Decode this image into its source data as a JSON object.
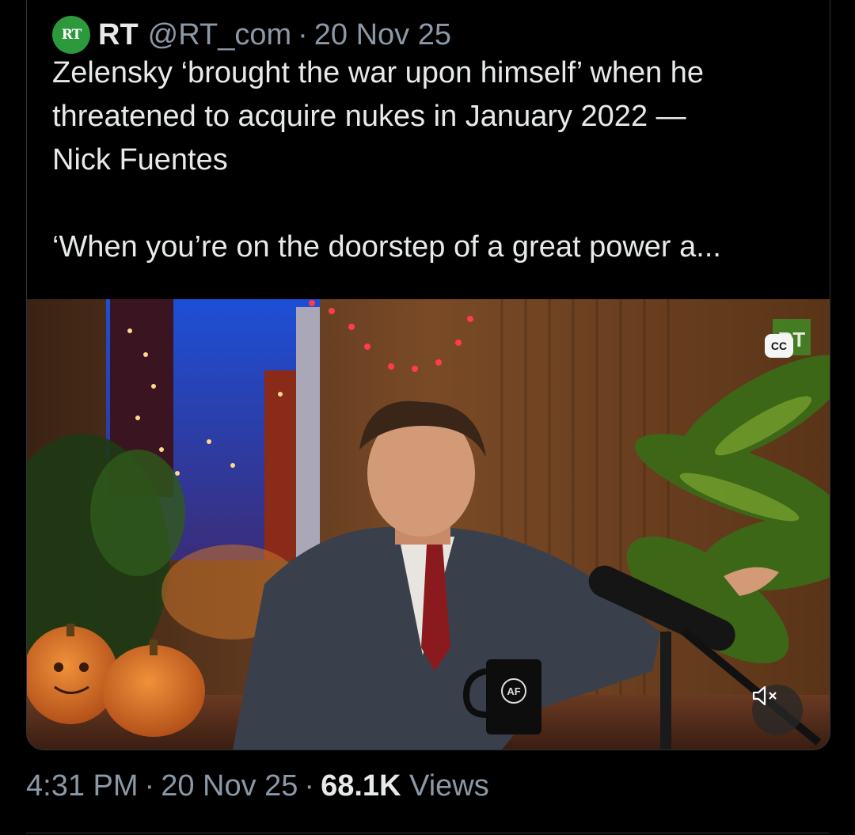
{
  "quoted_tweet": {
    "avatar_text": "RT",
    "display_name": "RT",
    "handle": "@RT_com",
    "separator": "·",
    "date": "20 Nov 25",
    "text_lines": [
      "Zelensky ‘brought the war upon himself’ when he",
      "threatened to acquire nukes in January 2022 —",
      "Nick Fuentes"
    ],
    "text_line_2": "‘When you’re on the doorstep of a great power a...",
    "media": {
      "cc_label": "CC",
      "mug_logo": "AF",
      "watermark": "RT",
      "mute_icon": "mute-icon"
    }
  },
  "footer": {
    "time": "4:31 PM",
    "separator": "·",
    "date": "20 Nov 25",
    "views_count": "68.1K",
    "views_label": "Views"
  },
  "colors": {
    "background": "#000000",
    "text_primary": "#e7e9ea",
    "text_secondary": "#8b98a5",
    "border": "#2f3336",
    "rt_green": "#2c9a3c"
  }
}
